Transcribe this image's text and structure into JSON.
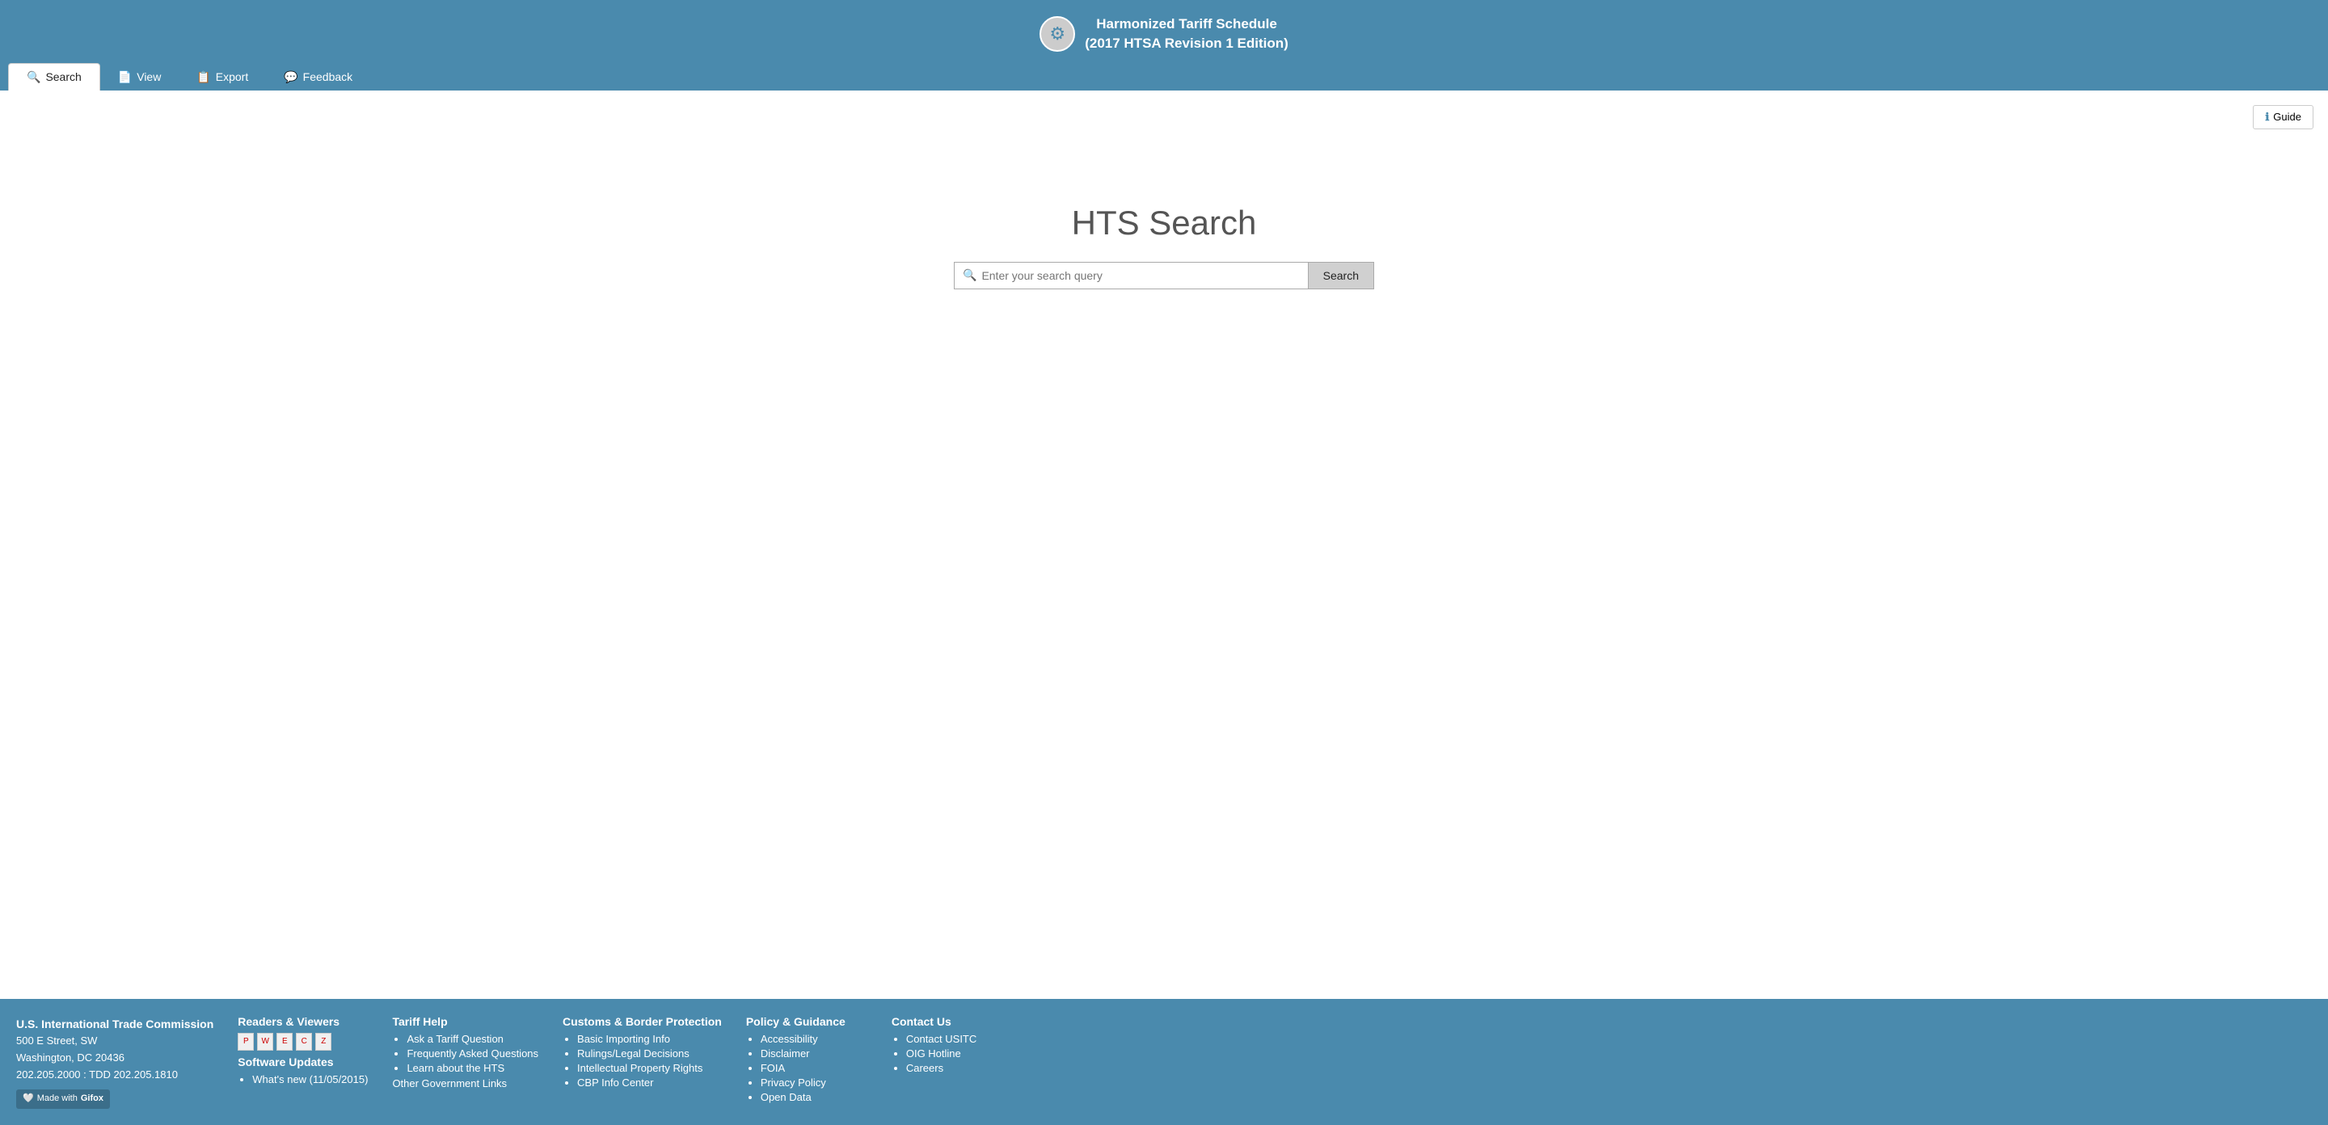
{
  "header": {
    "title_line1": "Harmonized Tariff Schedule",
    "title_line2": "(2017 HTSA Revision 1 Edition)"
  },
  "nav": {
    "tabs": [
      {
        "id": "search",
        "label": "Search",
        "icon": "🔍",
        "active": true
      },
      {
        "id": "view",
        "label": "View",
        "icon": "📄",
        "active": false
      },
      {
        "id": "export",
        "label": "Export",
        "icon": "📋",
        "active": false
      },
      {
        "id": "feedback",
        "label": "Feedback",
        "icon": "💬",
        "active": false
      }
    ]
  },
  "guide_btn": "Guide",
  "main": {
    "hts_title": "HTS Search",
    "search_placeholder": "Enter your search query",
    "search_button": "Search"
  },
  "footer": {
    "usitc": {
      "org": "U.S. International Trade Commission",
      "address1": "500 E Street, SW",
      "address2": "Washington, DC 20436",
      "phone": "202.205.2000 : TDD 202.205.1810",
      "made_with": "Made with",
      "gifox": "Gifox"
    },
    "readers": {
      "title": "Readers & Viewers",
      "software_updates_title": "Software Updates",
      "software_updates_items": [
        {
          "label": "What's new (11/05/2015)"
        }
      ]
    },
    "tariff_help": {
      "title": "Tariff Help",
      "items": [
        {
          "label": "Ask a Tariff Question"
        },
        {
          "label": "Frequently Asked Questions"
        },
        {
          "label": "Learn about the HTS"
        }
      ],
      "other_gov": "Other Government Links"
    },
    "customs": {
      "title": "Customs & Border Protection",
      "items": [
        {
          "label": "Basic Importing Info"
        },
        {
          "label": "Rulings/Legal Decisions"
        },
        {
          "label": "Intellectual Property Rights"
        },
        {
          "label": "CBP Info Center"
        }
      ]
    },
    "policy": {
      "title": "Policy & Guidance",
      "items": [
        {
          "label": "Accessibility"
        },
        {
          "label": "Disclaimer"
        },
        {
          "label": "FOIA"
        },
        {
          "label": "Privacy Policy"
        },
        {
          "label": "Open Data"
        }
      ]
    },
    "contact": {
      "title": "Contact Us",
      "items": [
        {
          "label": "Contact USITC"
        },
        {
          "label": "OIG Hotline"
        },
        {
          "label": "Careers"
        }
      ]
    }
  }
}
